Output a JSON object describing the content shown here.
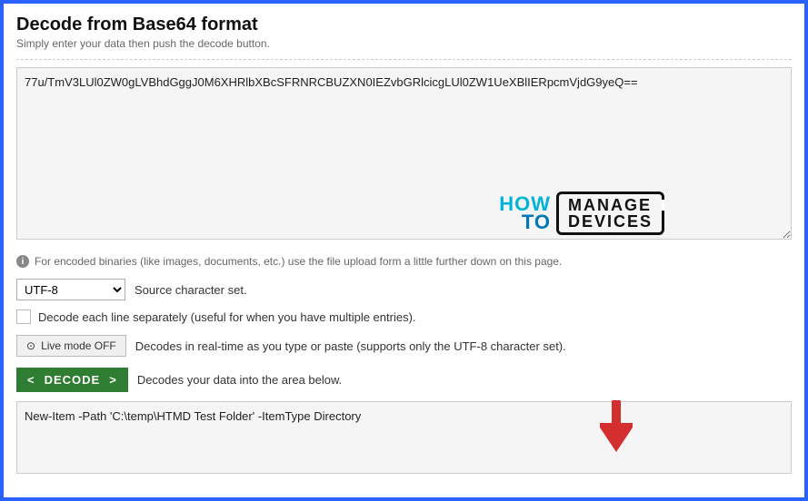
{
  "header": {
    "title": "Decode from Base64 format",
    "subtitle": "Simply enter your data then push the decode button."
  },
  "input": {
    "value": "77u/TmV3LUl0ZW0gLVBhdGggJ0M6XHRlbXBcSFRNRCBUZXN0IEZvbGRlcicgLUl0ZW1UeXBlIERpcmVjdG9yeQ=="
  },
  "watermark": {
    "how": "HOW",
    "to": "TO",
    "line1": "MANAGE",
    "line2": "DEVICES"
  },
  "hints": {
    "binary": "For encoded binaries (like images, documents, etc.) use the file upload form a little further down on this page."
  },
  "charset": {
    "selected": "UTF-8",
    "label": "Source character set."
  },
  "checkbox": {
    "label": "Decode each line separately (useful for when you have multiple entries)."
  },
  "live": {
    "button": "Live mode OFF",
    "desc": "Decodes in real-time as you type or paste (supports only the UTF-8 character set)."
  },
  "decode": {
    "button": "DECODE",
    "desc": "Decodes your data into the area below."
  },
  "output": {
    "value": "New-Item -Path 'C:\\temp\\HTMD Test Folder' -ItemType Directory"
  }
}
